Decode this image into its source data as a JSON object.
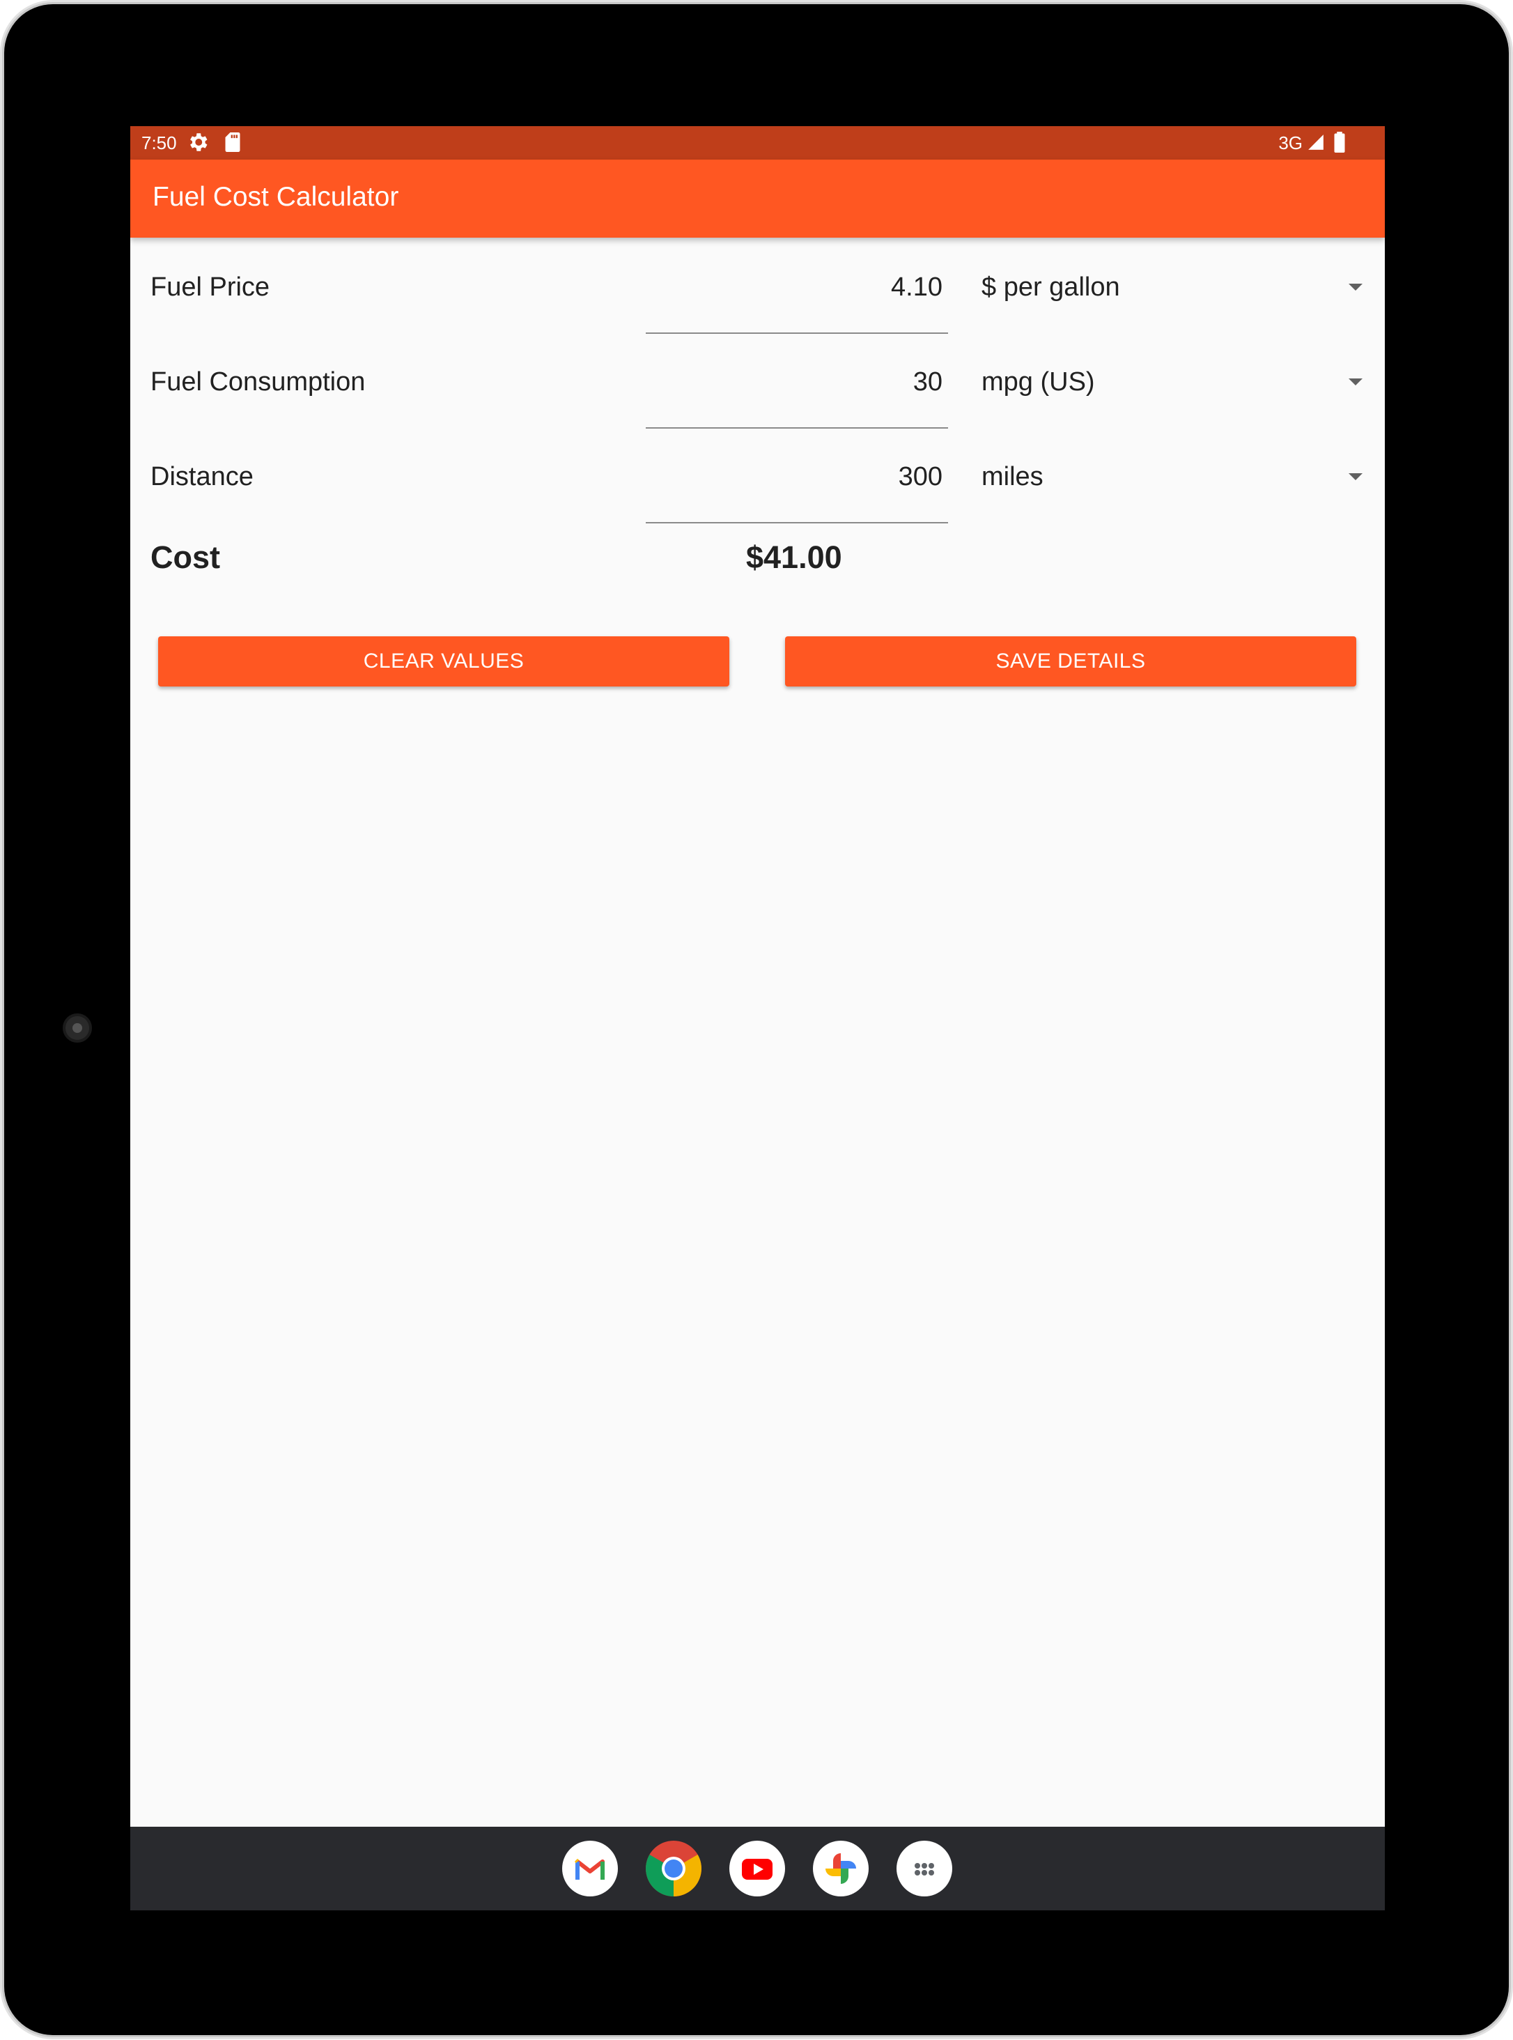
{
  "status_bar": {
    "time": "7:50",
    "network": "3G",
    "icons": [
      "settings-icon",
      "sd-card-icon",
      "signal-icon",
      "battery-icon"
    ]
  },
  "app_bar": {
    "title": "Fuel Cost Calculator",
    "color": "#ff5722",
    "status_color": "#bf3e1a"
  },
  "form": {
    "fuel_price": {
      "label": "Fuel Price",
      "value": "4.10",
      "unit": "$ per gallon"
    },
    "fuel_consumption": {
      "label": "Fuel Consumption",
      "value": "30",
      "unit": "mpg (US)"
    },
    "distance": {
      "label": "Distance",
      "value": "300",
      "unit": "miles"
    }
  },
  "result": {
    "label": "Cost",
    "value": "$41.00"
  },
  "buttons": {
    "clear": "CLEAR VALUES",
    "save": "SAVE DETAILS"
  },
  "dock": {
    "apps": [
      "gmail-icon",
      "chrome-icon",
      "youtube-icon",
      "photos-icon",
      "app-drawer-icon"
    ]
  }
}
